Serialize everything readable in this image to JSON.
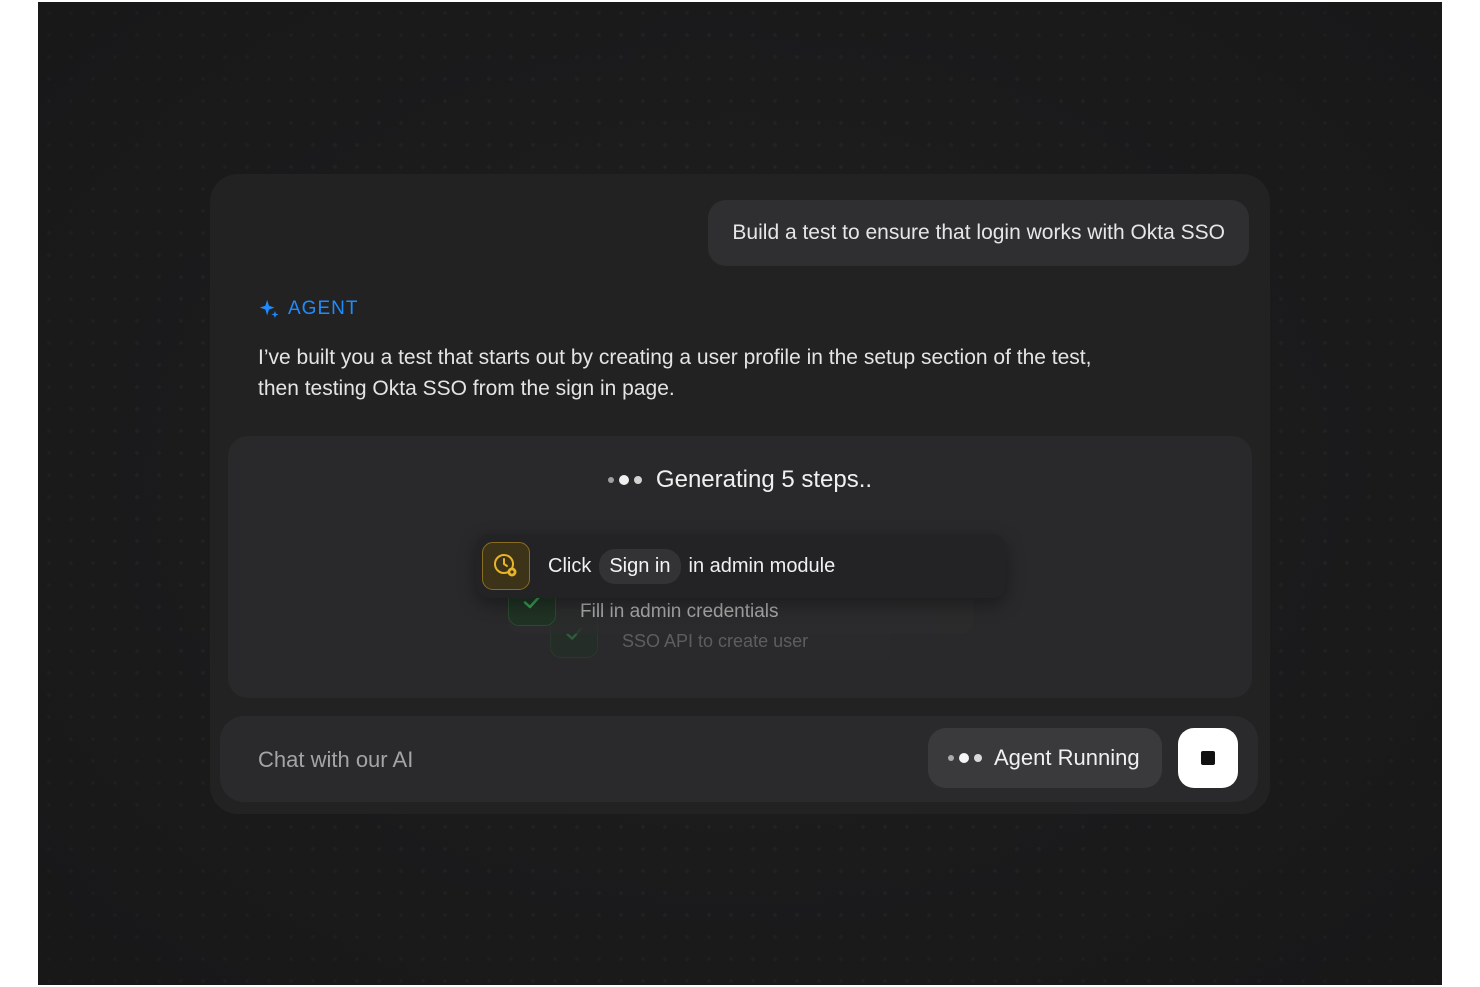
{
  "user_message": "Build a test to ensure that login works with Okta SSO",
  "agent": {
    "label": "AGENT",
    "icon": "sparkle-icon",
    "message": "I’ve built you a test that starts out by creating a user profile in the setup section of the test, then testing Okta SSO from the sign in page."
  },
  "generation": {
    "status": "Generating 5 steps..",
    "steps": [
      {
        "icon": "clock-gear-icon",
        "prefix": "Click",
        "chip": "Sign in",
        "suffix": "in admin module"
      },
      {
        "icon": "check-icon",
        "text": "Fill in admin credentials"
      },
      {
        "icon": "check-icon",
        "text": "SSO API to create user"
      }
    ]
  },
  "composer": {
    "placeholder": "Chat with our AI",
    "status_label": "Agent Running",
    "stop_icon": "stop-icon"
  },
  "colors": {
    "accent": "#1e8cff",
    "background": "#1c1c1d",
    "panel": "#222223",
    "pending": "#e8b52a",
    "success": "#3fbf5f"
  }
}
